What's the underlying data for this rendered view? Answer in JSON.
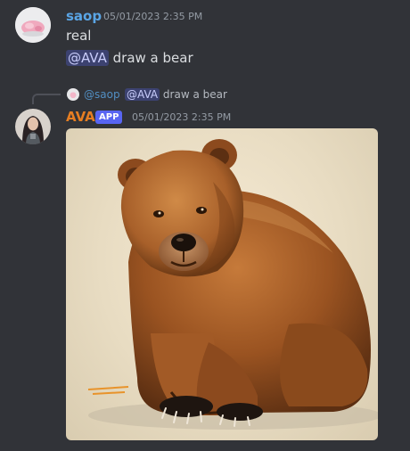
{
  "messages": [
    {
      "author": "saop",
      "author_color": "#5aa5e5",
      "timestamp": "05/01/2023 2:35 PM",
      "lines": {
        "line1": "real",
        "line2_mention": "@AVA",
        "line2_text": " draw a bear"
      }
    },
    {
      "reply": {
        "author": "@saop",
        "mention": "@AVA",
        "text": " draw a bear"
      },
      "author": "AVA",
      "author_color": "#e67e22",
      "badge": "APP",
      "timestamp": "05/01/2023 2:35 PM",
      "attachment": {
        "type": "image",
        "subject": "bear"
      }
    }
  ],
  "colors": {
    "background": "#313338",
    "mention_bg": "#3c4270",
    "badge_bg": "#5865f2"
  }
}
